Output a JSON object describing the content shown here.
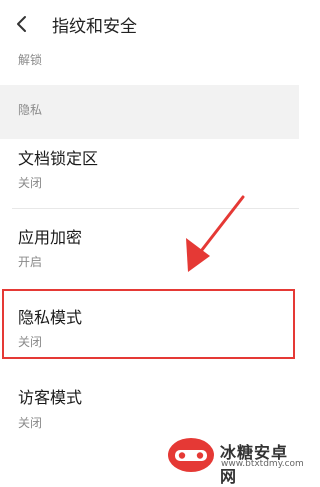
{
  "header": {
    "title": "指纹和安全"
  },
  "top_row": {
    "status": "解锁"
  },
  "section": {
    "label": "隐私"
  },
  "items": [
    {
      "title": "文档锁定区",
      "status": "关闭"
    },
    {
      "title": "应用加密",
      "status": "开启"
    },
    {
      "title": "隐私模式",
      "status": "关闭"
    },
    {
      "title": "访客模式",
      "status": "关闭"
    }
  ],
  "annotation": {
    "color": "#e53935",
    "target": "隐私模式"
  },
  "watermark": {
    "title": "冰糖安卓网",
    "url": "www.btxtdmy.com"
  }
}
